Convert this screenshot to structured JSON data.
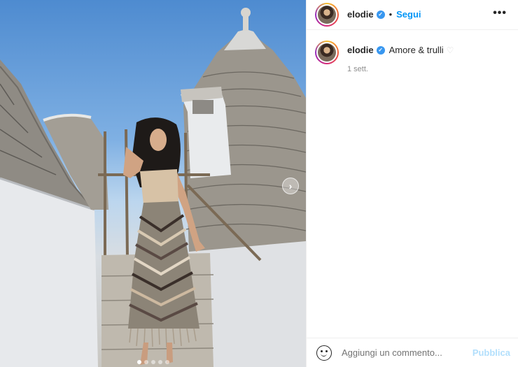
{
  "post": {
    "image_description_icon": "photo",
    "carousel": {
      "total_dots": 5,
      "active_dot": 0
    }
  },
  "header": {
    "username": "elodie",
    "separator": "•",
    "follow_label": "Segui",
    "more_icon": "more-horizontal-icon",
    "more_label": "•••"
  },
  "caption": {
    "username": "elodie",
    "text": "Amore & trulli",
    "heart": "♡",
    "time": "1 sett."
  },
  "comment": {
    "placeholder": "Aggiungi un commento...",
    "publish_label": "Pubblica",
    "emoji_icon": "emoji-icon"
  },
  "colors": {
    "link_blue": "#0095f6",
    "publish_disabled": "#b2dffc",
    "verified_blue": "#3897f0",
    "muted": "#8e8e8e"
  }
}
